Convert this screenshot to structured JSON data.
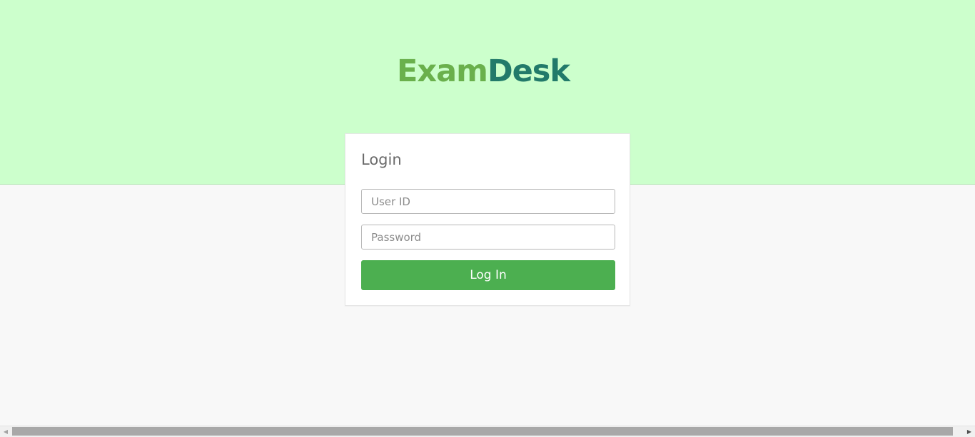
{
  "brand": {
    "logo_part_a": "Exam",
    "logo_part_b": "Desk",
    "color_a": "#6ab04c",
    "color_b": "#227a6a"
  },
  "colors": {
    "header_band": "#ccffcc",
    "page_background": "#f8f8f8",
    "primary_button": "#4caf50"
  },
  "login": {
    "title": "Login",
    "user_id_placeholder": "User ID",
    "password_placeholder": "Password",
    "submit_label": "Log In"
  },
  "scrollbar": {
    "left_arrow": "◀",
    "right_arrow": "▶"
  }
}
